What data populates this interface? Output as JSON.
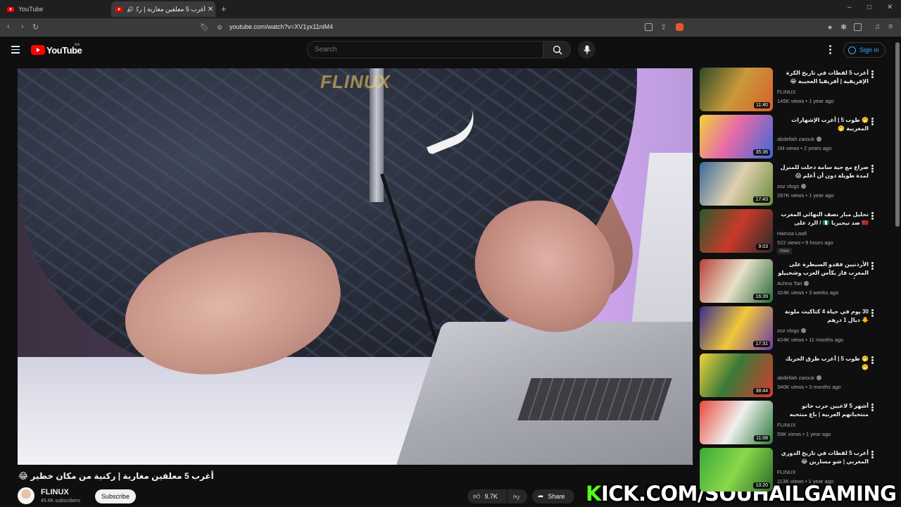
{
  "browser": {
    "tabs": [
      {
        "title": "YouTube",
        "active": false
      },
      {
        "title": "أغرب 5 معلقين مغاربة | ركنية من...",
        "active": true
      }
    ],
    "new_tab_icon": "plus-icon",
    "url": "youtube.com/watch?v=XV1yx11niM4",
    "window_controls": {
      "minimize": "–",
      "maximize": "□",
      "close": "✕"
    }
  },
  "header": {
    "logo_text": "YouTube",
    "region": "MA",
    "search_placeholder": "Search",
    "signin_label": "Sign in"
  },
  "video": {
    "watermark": "FLINUX",
    "title": "أغرب 5 معلقين مغاربة | ركنية من مكان خطير 😂",
    "channel": "FLINUX",
    "subscribers": "45.6K subscribers",
    "subscribe_label": "Subscribe",
    "likes": "9.7K",
    "share_label": "Share",
    "overlay_banner_prefix": "K",
    "overlay_banner_rest": "ICK.COM/SOUHAILGAMING"
  },
  "sidebar": {
    "items": [
      {
        "title": "أغرب 5 لقطات في تاريخ الكرة الإفريقية | أفريقيا العجيبة 😂",
        "channel": "FLINUX",
        "meta": "145K views • 1 year ago",
        "duration": "11:40",
        "verified": false,
        "badge": ""
      },
      {
        "title": "🤭 طوب 5 | أغرب الإشهارات المغربية 🤭",
        "channel": "abdellah zarouk",
        "meta": "1M views • 2 years ago",
        "duration": "35:36",
        "verified": true,
        "badge": ""
      },
      {
        "title": "صراع مع حية سامة دخلت للمنزل لمدة طويلة دون أن أعلم 😱",
        "channel": "zoz vlogs",
        "meta": "297K views • 1 year ago",
        "duration": "17:43",
        "verified": true,
        "badge": ""
      },
      {
        "title": "تحليل مبار نصف النهائي المغرب 🇲🇦 ضد نيجيريا 🇳🇬 / الرد على الإعلام المجاور",
        "channel": "Hamza Laafi",
        "meta": "522 views • 9 hours ago",
        "duration": "9:03",
        "verified": false,
        "badge": "New"
      },
      {
        "title": "الأردنيين فقدو السيطرة على المغرب فاز بكأس العرب وشخبيلو على أشنو داوو",
        "channel": "Achno Tari",
        "meta": "324K views • 3 weeks ago",
        "duration": "16:39",
        "verified": true,
        "badge": ""
      },
      {
        "title": "30 يوم في حياة 4 كتاكيت ملونة 🐥 ديال 1 درهم",
        "channel": "zoz vlogs",
        "meta": "424K views • 11 months ago",
        "duration": "17:31",
        "verified": true,
        "badge": ""
      },
      {
        "title": "🤭 طوب 5 | أغرب طرق الحريك 🤭",
        "channel": "abdellah zarouk",
        "meta": "340K views • 3 months ago",
        "duration": "38:44",
        "verified": true,
        "badge": ""
      },
      {
        "title": "أشهر 5 لاعبين حرب خانو منتخباتهم العربية | باع منتخبه",
        "channel": "FLINUX",
        "meta": "59K views • 1 year ago",
        "duration": "11:08",
        "verified": false,
        "badge": ""
      },
      {
        "title": "أغرب 5 لقطات في تاريخ الدوري المغربي | شو مسارين 😂",
        "channel": "FLINUX",
        "meta": "113K views • 1 year ago",
        "duration": "10:20",
        "verified": false,
        "badge": ""
      }
    ]
  },
  "colors": {
    "background": "#0f0f0f",
    "accent": "#ff0000",
    "link": "#3ea6ff",
    "kick_green": "#53fc18"
  }
}
